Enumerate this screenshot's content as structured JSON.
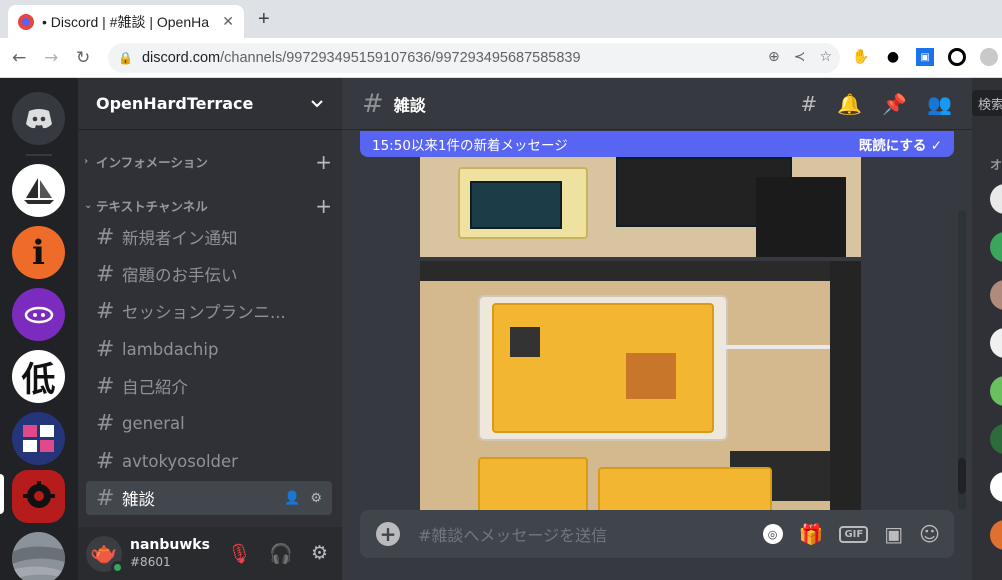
{
  "browser": {
    "tab_title": "• Discord | #雑談 | OpenHa",
    "tab_close": "✕",
    "new_tab": "+",
    "url_host": "discord.com",
    "url_path": "/channels/997293495159107636/997293495687585839"
  },
  "server": {
    "name": "OpenHardTerrace"
  },
  "categories": [
    {
      "label": "インフォメーション"
    },
    {
      "label": "テキストチャンネル"
    }
  ],
  "channels": [
    {
      "label": "新規者イン通知"
    },
    {
      "label": "宿題のお手伝い"
    },
    {
      "label": "セッションプランニ..."
    },
    {
      "label": "lambdachip"
    },
    {
      "label": "自己紹介"
    },
    {
      "label": "general"
    },
    {
      "label": "avtokyosolder"
    },
    {
      "label": "雑談"
    }
  ],
  "user": {
    "name": "nanbuwks",
    "tag": "#8601"
  },
  "chat": {
    "channel_name": "雑談",
    "banner_text": "15:50以来1件の新着メッセージ",
    "banner_action": "既読にする",
    "composer_placeholder": "#雑談へメッセージを送信",
    "gif_label": "GIF"
  },
  "search": {
    "label": "検索"
  },
  "members_heading": "オ",
  "servers": [
    {
      "icon": "discord-home-icon",
      "color": "#36393f"
    },
    {
      "icon": "sailboat-server-icon",
      "color": "#ffffff"
    },
    {
      "icon": "i-server-icon",
      "color": "#ef6b2a"
    },
    {
      "icon": "purple-server-icon",
      "color": "#7b2cbf"
    },
    {
      "icon": "kanji-server-icon",
      "color": "#ffffff",
      "text": "低"
    },
    {
      "icon": "sm-server-icon",
      "color": "#25357a"
    },
    {
      "icon": "open-source-hardware-icon",
      "color": "#b71c1c"
    },
    {
      "icon": "stone-server-icon",
      "color": "#8b9299"
    }
  ]
}
